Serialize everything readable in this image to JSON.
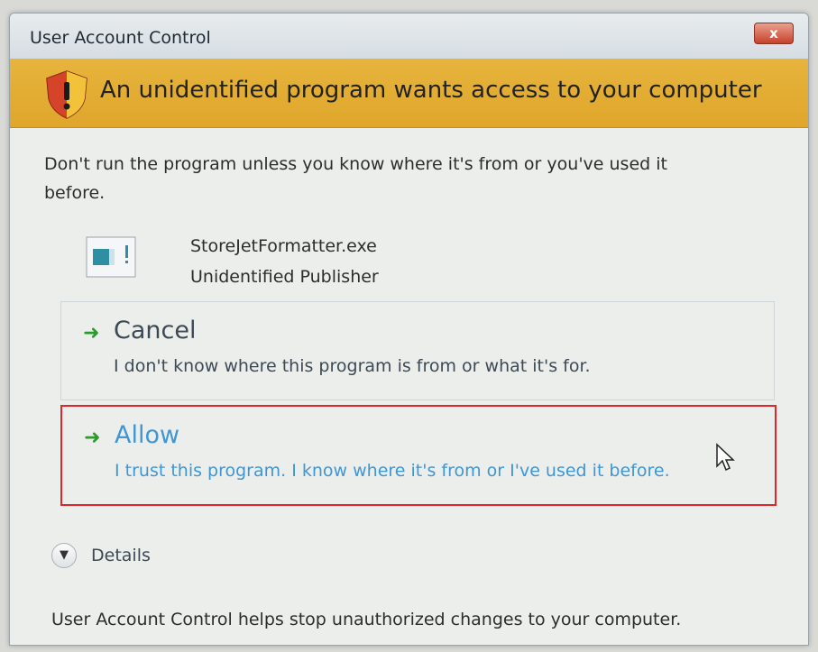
{
  "window": {
    "title": "User Account Control",
    "close_label": "x"
  },
  "banner": {
    "text": "An unidentified program wants access to your computer",
    "icon": "security-shield-icon"
  },
  "warning": {
    "text": "Don't run the program unless you know where it's from or you've used it before."
  },
  "program": {
    "name": "StoreJetFormatter.exe",
    "publisher": "Unidentified Publisher",
    "icon": "program-window-icon"
  },
  "options": {
    "cancel": {
      "title": "Cancel",
      "description": "I don't know where this program is from or what it's for."
    },
    "allow": {
      "title": "Allow",
      "description": "I trust this program. I know where it's from or I've used it before."
    }
  },
  "details": {
    "label": "Details"
  },
  "footer": {
    "text": "User Account Control helps stop unauthorized changes to your computer."
  },
  "colors": {
    "banner": "#e2ad35",
    "accent_link": "#3f96d4",
    "highlight_border": "#e0262a",
    "arrow_green": "#2c9b2c"
  }
}
